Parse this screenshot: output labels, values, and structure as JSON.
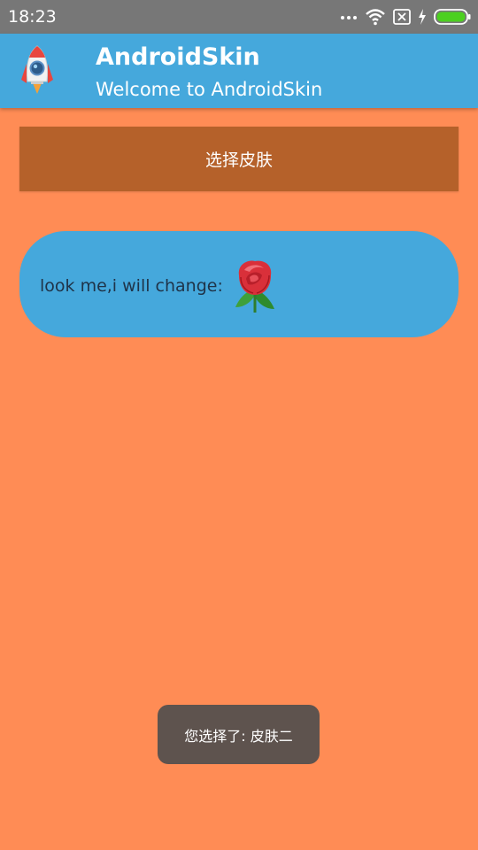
{
  "status_bar": {
    "time": "18:23",
    "icons": [
      "more-dots-icon",
      "wifi-icon",
      "no-sim-icon",
      "charging-bolt-icon",
      "battery-icon"
    ]
  },
  "app_bar": {
    "logo_icon": "rocket-icon",
    "title": "AndroidSkin",
    "subtitle": "Welcome to AndroidSkin"
  },
  "main": {
    "select_skin_label": "选择皮肤",
    "demo_label": "look me,i will change:",
    "demo_icon": "rose-icon"
  },
  "toast": {
    "text": "您选择了: 皮肤二"
  },
  "colors": {
    "background": "#FF8C55",
    "app_bar": "#45A8DC",
    "button": "#B5612A",
    "card": "#45A8DC",
    "toast": "#5E534E",
    "battery": "#4CD020"
  }
}
